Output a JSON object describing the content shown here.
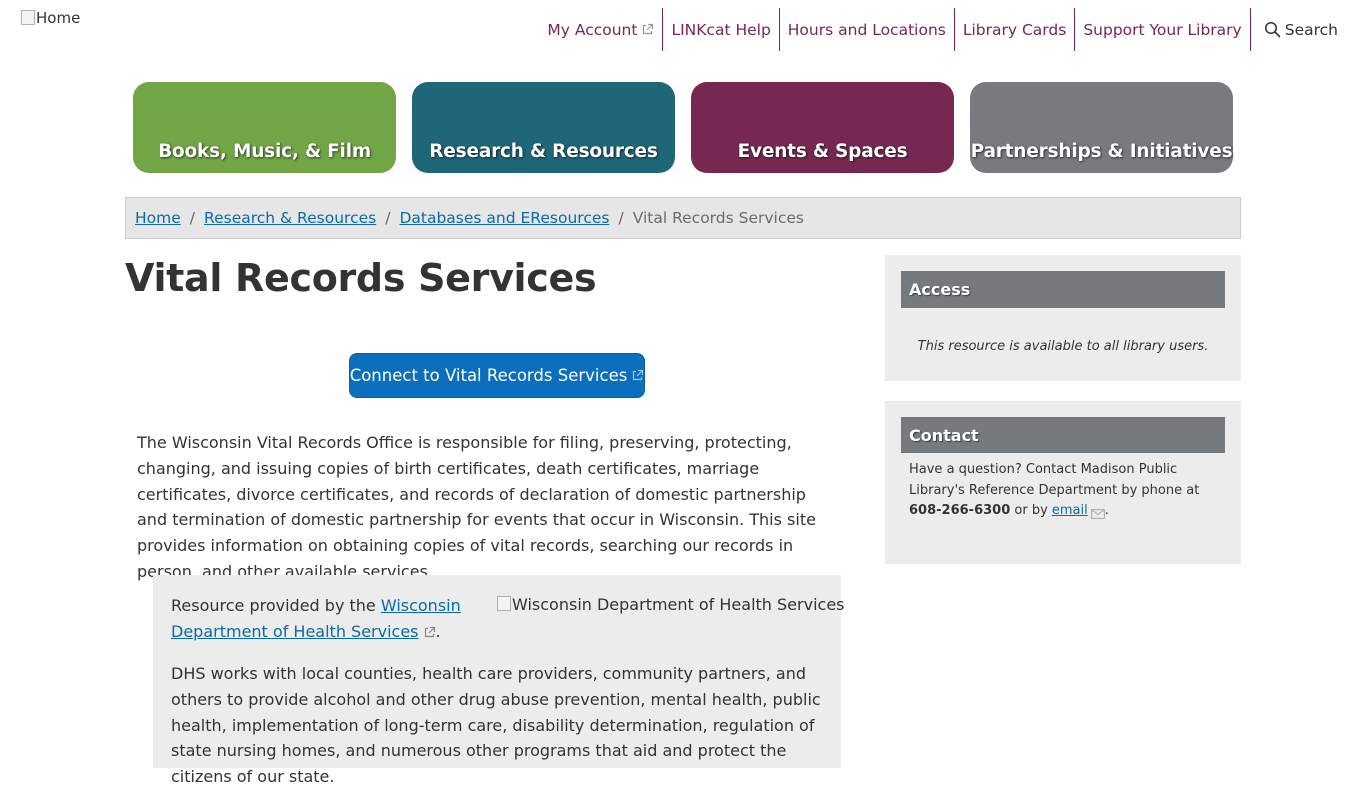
{
  "header": {
    "logo_alt": "Home",
    "utility_nav": [
      {
        "label": "My Account",
        "icon": "external-link-icon"
      },
      {
        "label": "LINKcat Help"
      },
      {
        "label": "Hours and Locations"
      },
      {
        "label": "Library Cards"
      },
      {
        "label": "Support Your Library"
      }
    ],
    "search": {
      "label": "Search",
      "icon": "search-icon"
    }
  },
  "main_nav": [
    {
      "label": "Books, Music, & Film",
      "color": "#72a545"
    },
    {
      "label": "Research & Resources",
      "color": "#1e6779"
    },
    {
      "label": "Events & Spaces",
      "color": "#772850"
    },
    {
      "label": "Partnerships & Initiatives",
      "color": "#787a7d"
    }
  ],
  "breadcrumb": {
    "items": [
      "Home",
      "Research & Resources",
      "Databases and EResources"
    ],
    "current": "Vital Records Services"
  },
  "page": {
    "title": "Vital Records Services",
    "connect_button": "Connect to Vital Records Services",
    "intro": "The Wisconsin Vital Records Office is responsible for filing, preserving, protecting, changing, and issuing copies of birth certificates, death certificates, marriage certificates, divorce certificates, and records of declaration of domestic partnership and termination of domestic partnership for events that occur in Wisconsin. This site provides information on obtaining copies of vital records, searching our records in person, and other available services."
  },
  "provider": {
    "prefix": "Resource provided by the ",
    "link": "Wisconsin Department of Health Services",
    "suffix": ".",
    "logo_alt": "Wisconsin Department of Health Services",
    "description": "DHS works with local counties, health care providers, community partners, and others to provide alcohol and other drug abuse prevention, mental health, public health, implementation of long-term care, disability determination, regulation of state nursing homes, and numerous other programs that aid and protect the citizens of our state."
  },
  "sidebar": {
    "access": {
      "heading": "Access",
      "text": "This resource is available to all library users."
    },
    "contact": {
      "heading": "Contact",
      "text_before": "Have a question? Contact Madison Public Library's Reference Department by phone at ",
      "phone": "608-266-6300",
      "text_mid": " or by ",
      "email_label": "email",
      "text_after": "."
    }
  },
  "colors": {
    "utility_link": "#7b2650",
    "link": "#0b6aa9",
    "button": "#0b6fbd",
    "sidebar_header": "#777a7d"
  }
}
